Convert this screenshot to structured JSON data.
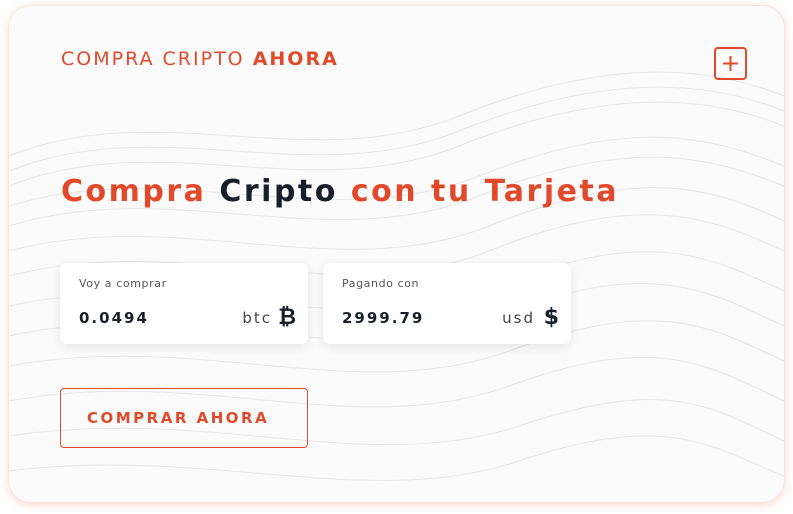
{
  "header": {
    "brand_light": "COMPRA CRIPTO",
    "brand_bold": "AHORA"
  },
  "headline": {
    "part1": "Compra",
    "part2": "Cripto",
    "part3": "con tu Tarjeta"
  },
  "buy_field": {
    "label": "Voy a comprar",
    "value": "0.0494",
    "unit": "btc",
    "icon": "bitcoin-icon"
  },
  "pay_field": {
    "label": "Pagando con",
    "value": "2999.79",
    "unit": "usd",
    "icon": "dollar-icon"
  },
  "cta": {
    "label": "COMPRAR AHORA"
  },
  "colors": {
    "accent": "#e04a2a",
    "dark_text": "#17202a",
    "card_bg": "#fbfbfb"
  }
}
